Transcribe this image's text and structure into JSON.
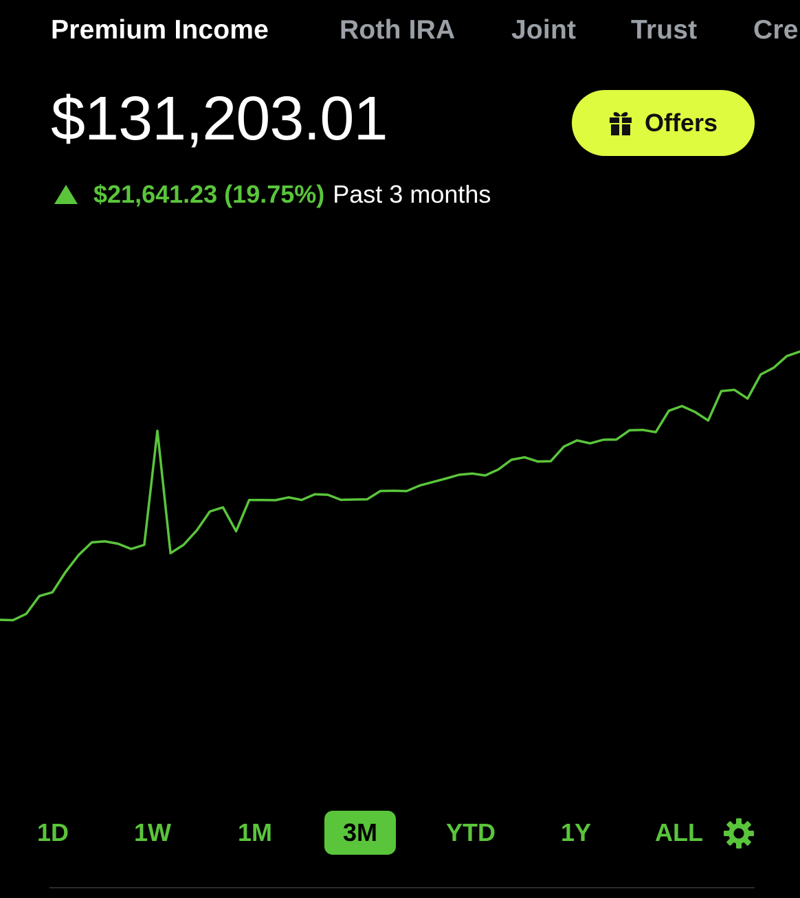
{
  "tabs": [
    {
      "label": "Premium Income",
      "active": true
    },
    {
      "label": "Roth IRA",
      "active": false
    },
    {
      "label": "Joint",
      "active": false
    },
    {
      "label": "Trust",
      "active": false
    },
    {
      "label": "Cre",
      "active": false
    }
  ],
  "balance": "$131,203.01",
  "offers_label": "Offers",
  "change": {
    "amount": "$21,641.23 (19.75%)",
    "period": "Past 3 months",
    "direction": "up"
  },
  "colors": {
    "positive": "#5ac53b",
    "offers_bg": "#dffb3f",
    "background": "#000000",
    "inactive_tab": "#9aa0a6"
  },
  "chart_data": {
    "type": "line",
    "title": "",
    "xlabel": "",
    "ylabel": "",
    "grid": false,
    "legend": "none",
    "x": [
      0,
      1,
      2,
      3,
      4,
      5,
      6,
      7,
      8,
      9,
      10,
      11,
      12,
      13,
      14,
      15,
      16,
      17,
      18,
      19,
      20,
      21,
      22,
      23,
      24,
      25,
      26,
      27,
      28,
      29,
      30,
      31,
      32,
      33,
      34,
      35,
      36,
      37,
      38,
      39,
      40,
      41,
      42,
      43,
      44,
      45,
      46,
      47,
      48,
      49,
      50,
      51,
      52,
      53,
      54,
      55,
      56,
      57,
      58,
      59,
      60,
      61
    ],
    "series": [
      {
        "values": [
          109560,
          109540,
          109900,
          110920,
          111140,
          112300,
          113280,
          114000,
          114060,
          113920,
          113620,
          113860,
          120400,
          113380,
          113860,
          114680,
          115770,
          116010,
          114640,
          116430,
          116430,
          116420,
          116580,
          116430,
          116760,
          116730,
          116440,
          116460,
          116470,
          116950,
          116960,
          116940,
          117260,
          117460,
          117660,
          117880,
          117950,
          117840,
          118180,
          118740,
          118880,
          118640,
          118660,
          119500,
          119850,
          119680,
          119890,
          119900,
          120430,
          120450,
          120320,
          121550,
          121820,
          121480,
          120990,
          122680,
          122750,
          122250,
          123630,
          124020,
          124690,
          124950
        ]
      }
    ],
    "ylim": [
      99000,
      132500
    ]
  },
  "ranges": [
    {
      "label": "1D",
      "selected": false
    },
    {
      "label": "1W",
      "selected": false
    },
    {
      "label": "1M",
      "selected": false
    },
    {
      "label": "3M",
      "selected": true
    },
    {
      "label": "YTD",
      "selected": false
    },
    {
      "label": "1Y",
      "selected": false
    },
    {
      "label": "ALL",
      "selected": false
    }
  ],
  "icons": {
    "offers": "gift-icon",
    "change": "triangle-up-icon",
    "settings": "gear-icon"
  }
}
